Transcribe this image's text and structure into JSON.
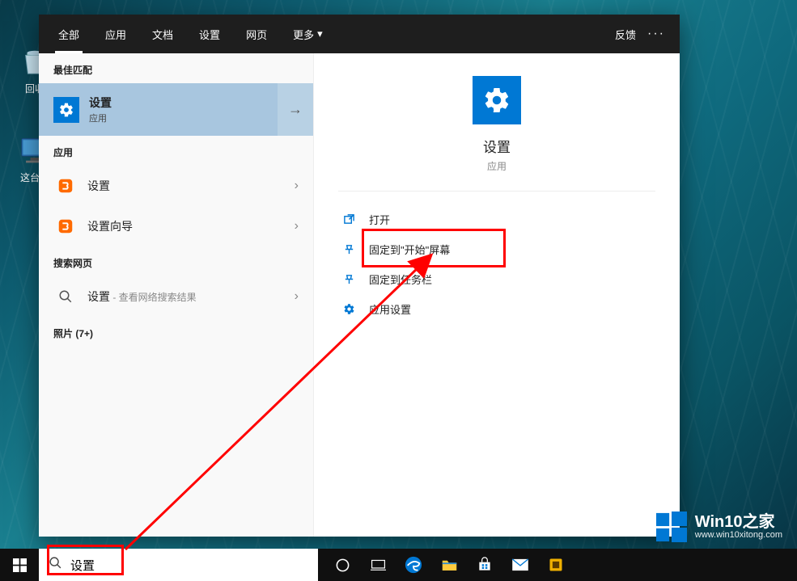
{
  "desktop": {
    "recycle_bin": "回收",
    "this_pc": "这台电"
  },
  "header": {
    "tabs": [
      "全部",
      "应用",
      "文档",
      "设置",
      "网页"
    ],
    "more": "更多",
    "feedback": "反馈"
  },
  "left": {
    "best_match": "最佳匹配",
    "settings_result": {
      "title": "设置",
      "sub": "应用"
    },
    "apps_heading": "应用",
    "app_items": [
      {
        "title": "设置"
      },
      {
        "title": "设置向导"
      }
    ],
    "web_heading": "搜索网页",
    "web_item": {
      "title": "设置",
      "sub": " - 查看网络搜索结果"
    },
    "photos_heading": "照片 (7+)"
  },
  "preview": {
    "title": "设置",
    "sub": "应用",
    "actions": [
      {
        "icon": "open",
        "label": "打开"
      },
      {
        "icon": "pin",
        "label": "固定到\"开始\"屏幕"
      },
      {
        "icon": "pin",
        "label": "固定到任务栏"
      },
      {
        "icon": "gear",
        "label": "应用设置"
      }
    ]
  },
  "search": {
    "value": "设置"
  },
  "watermark": {
    "title": "Win10之家",
    "url": "www.win10xitong.com"
  },
  "colors": {
    "accent": "#0078d4",
    "annotation": "#ff0000"
  }
}
